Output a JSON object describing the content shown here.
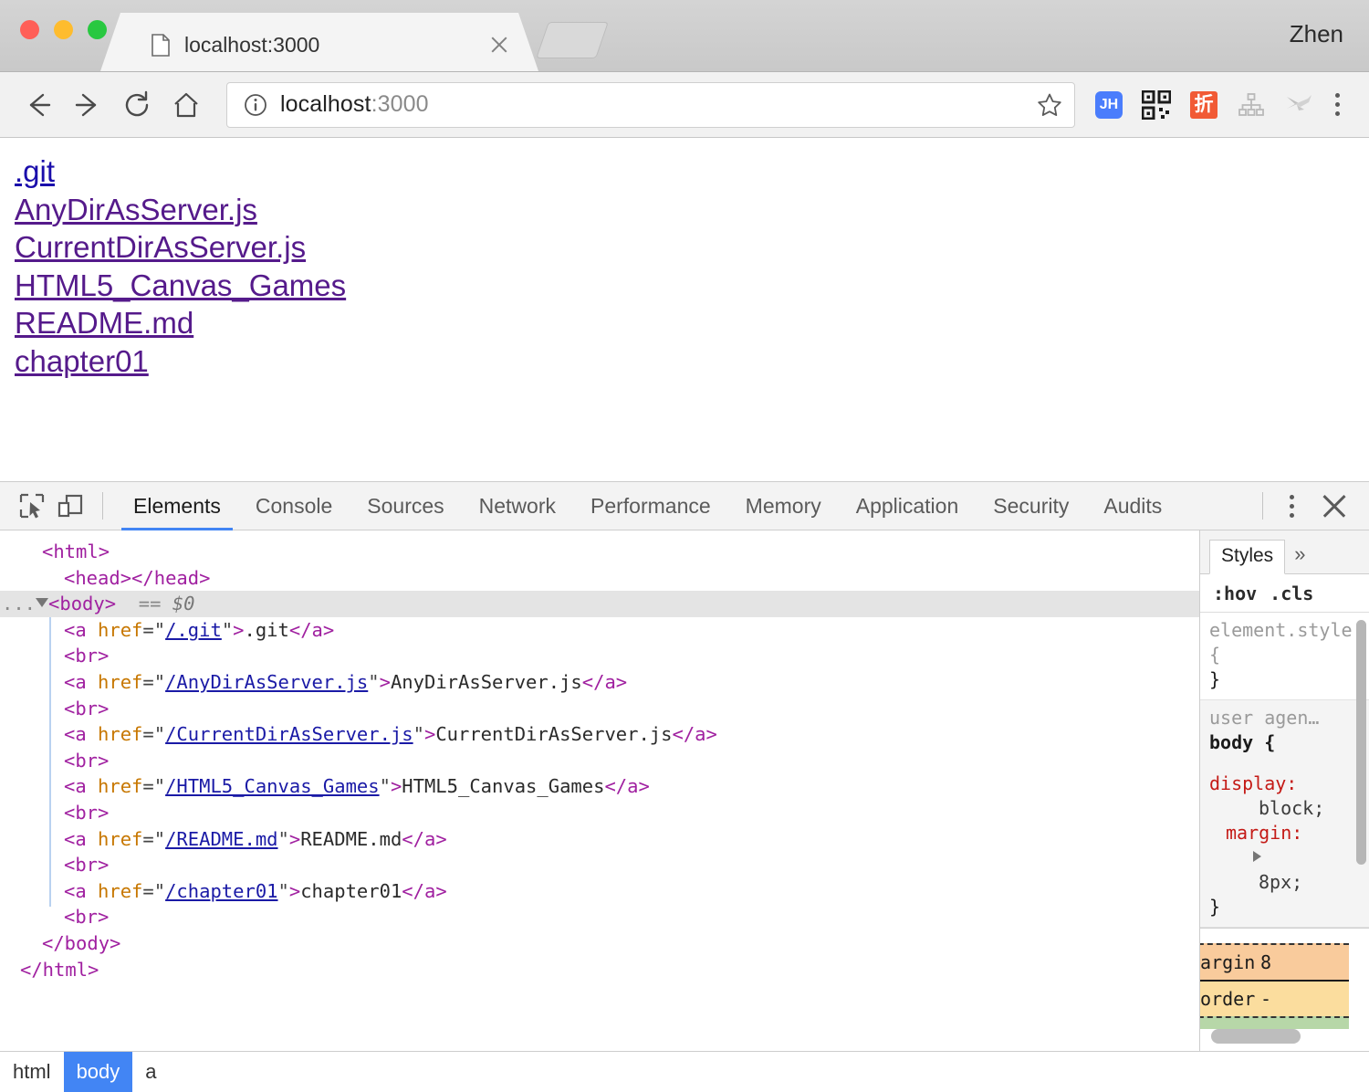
{
  "window": {
    "profile_name": "Zhen",
    "traffic_lights": [
      "close",
      "minimize",
      "zoom"
    ]
  },
  "tab": {
    "title": "localhost:3000",
    "favicon": "page-icon",
    "close_label": "×",
    "new_tab_label": "+"
  },
  "toolbar": {
    "back": "back-arrow",
    "forward": "forward-arrow",
    "reload": "reload-arrow",
    "home": "home-house",
    "url_host": "localhost",
    "url_port": ":3000",
    "url_full": "localhost:3000",
    "info_icon": "info-circle",
    "star_icon": "star-outline",
    "extensions": [
      {
        "name": "jh-extension",
        "label": "JH",
        "color": "#4a7dfc"
      },
      {
        "name": "qr-code-extension",
        "label": "",
        "color": "#1b1b1b"
      },
      {
        "name": "zhe-discount-extension",
        "label": "折",
        "color": "#f15a35"
      },
      {
        "name": "sitemap-extension",
        "label": "",
        "color": "#c7c7c7"
      },
      {
        "name": "hummingbird-extension",
        "label": "",
        "color": "#b8b8b8"
      }
    ],
    "menu": "three-dot-menu"
  },
  "page": {
    "links": [
      {
        "text": ".git",
        "state": "unvisited"
      },
      {
        "text": "AnyDirAsServer.js",
        "state": "visited"
      },
      {
        "text": "CurrentDirAsServer.js",
        "state": "visited"
      },
      {
        "text": "HTML5_Canvas_Games",
        "state": "visited"
      },
      {
        "text": "README.md",
        "state": "visited"
      },
      {
        "text": "chapter01",
        "state": "visited"
      }
    ]
  },
  "devtools": {
    "inspect_icon": "inspect-cursor-icon",
    "device_icon": "device-toolbar-icon",
    "tabs": [
      {
        "label": "Elements",
        "active": true
      },
      {
        "label": "Console",
        "active": false
      },
      {
        "label": "Sources",
        "active": false
      },
      {
        "label": "Network",
        "active": false
      },
      {
        "label": "Performance",
        "active": false
      },
      {
        "label": "Memory",
        "active": false
      },
      {
        "label": "Application",
        "active": false
      },
      {
        "label": "Security",
        "active": false
      },
      {
        "label": "Audits",
        "active": false
      }
    ],
    "more_menu": "three-dot-menu",
    "close": "close-devtools",
    "dom": {
      "l0": "<html>",
      "l1": "<head></head>",
      "l2_tag": "<body>",
      "l2_eq": "==",
      "l2_ref": "$0",
      "l2_ellipsis": "...",
      "a1_href": "/.git",
      "a1_text": ".git",
      "a2_href": "/AnyDirAsServer.js",
      "a2_text": "AnyDirAsServer.js",
      "a3_href": "/CurrentDirAsServer.js",
      "a3_text": "CurrentDirAsServer.js",
      "a4_href": "/HTML5_Canvas_Games",
      "a4_text": "HTML5_Canvas_Games",
      "a5_href": "/README.md",
      "a5_text": "README.md",
      "a6_href": "/chapter01",
      "a6_text": "chapter01",
      "br": "<br>",
      "a_open": "<a ",
      "attr": "href",
      "close_body": "</body>",
      "close_html": "</html>",
      "close_a": "</a>"
    },
    "styles": {
      "tab_label": "Styles",
      "more": "»",
      "hov": ":hov",
      "cls": ".cls",
      "rule1_selector": "element.style {",
      "rule1_close": "}",
      "rule2_origin": "user agen…",
      "rule2_selector": "body {",
      "rule2_close": "}",
      "prop_display": "display:",
      "val_display": "block;",
      "prop_margin": "margin:",
      "val_margin": "8px;"
    },
    "boxmodel": {
      "margin_label": "margin",
      "margin_value": "8",
      "border_label": "border",
      "border_value": "-",
      "colors": {
        "margin": "#f9cb9c",
        "border": "#fbdd9e",
        "padding": "#b7d7a8"
      }
    },
    "breadcrumb": [
      {
        "label": "html",
        "selected": false
      },
      {
        "label": "body",
        "selected": true
      },
      {
        "label": "a",
        "selected": false
      }
    ]
  }
}
